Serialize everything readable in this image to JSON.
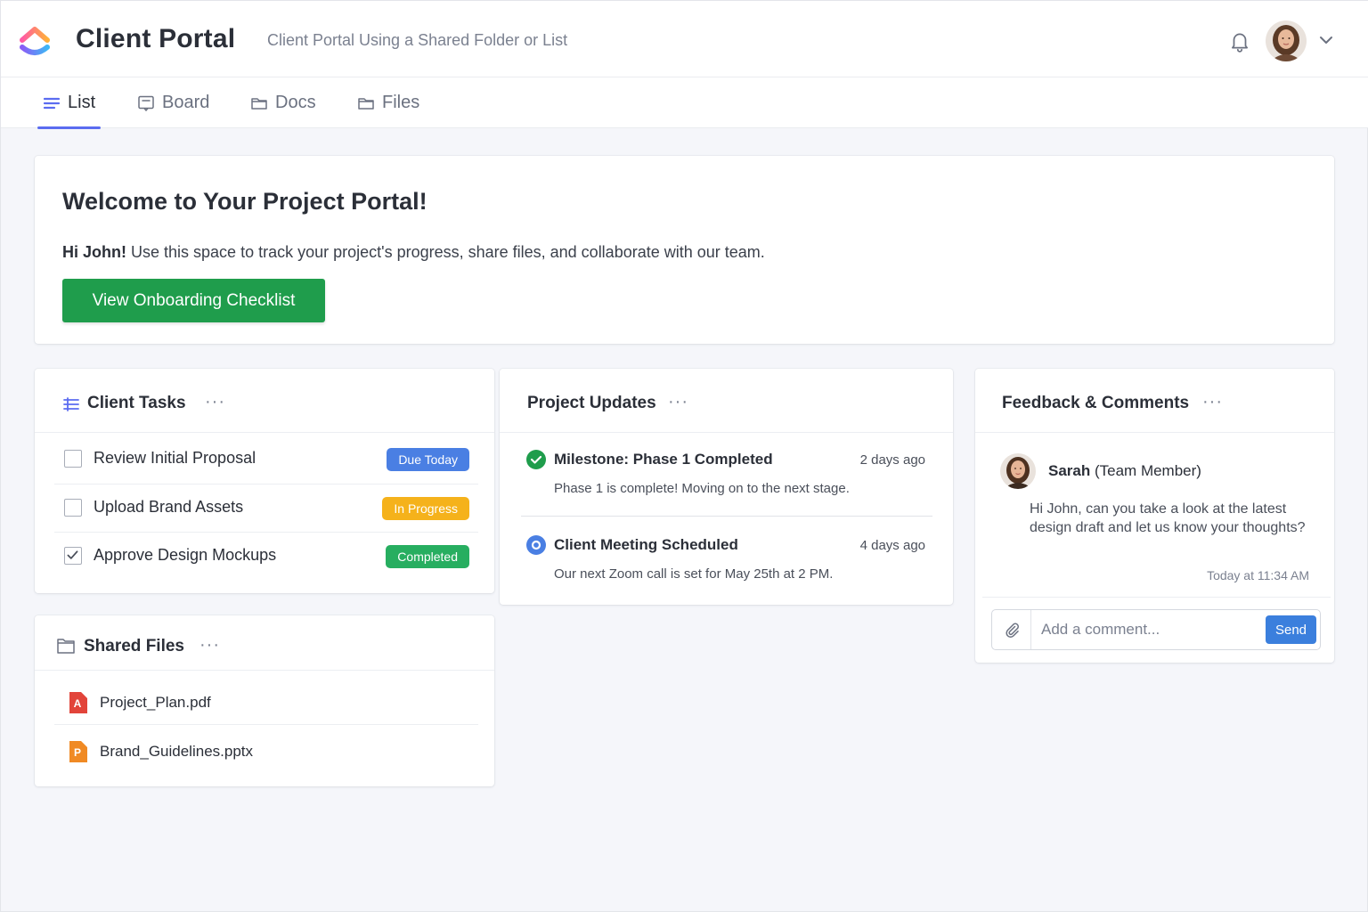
{
  "header": {
    "app_title": "Client Portal",
    "subtitle": "Client Portal Using a Shared Folder or List"
  },
  "tabs": [
    {
      "label": "List",
      "icon": "list-icon",
      "active": true
    },
    {
      "label": "Board",
      "icon": "board-icon",
      "active": false
    },
    {
      "label": "Docs",
      "icon": "folder-icon",
      "active": false
    },
    {
      "label": "Files",
      "icon": "folder-icon",
      "active": false
    }
  ],
  "welcome": {
    "title": "Welcome to Your Project Portal!",
    "greeting_name": "Hi John!",
    "message": "Use this space to track your project's progress, share files, and collaborate with our team.",
    "button_label": "View Onboarding Checklist"
  },
  "client_tasks": {
    "title": "Client Tasks",
    "menu": "···",
    "items": [
      {
        "label": "Review Initial Proposal",
        "checked": false,
        "status": "Due Today",
        "status_color": "#4a7fe3"
      },
      {
        "label": "Upload Brand Assets",
        "checked": false,
        "status": "In Progress",
        "status_color": "#f5b21b"
      },
      {
        "label": "Approve Design Mockups",
        "checked": true,
        "status": "Completed",
        "status_color": "#27ae60"
      }
    ]
  },
  "shared_files": {
    "title": "Shared Files",
    "menu": "···",
    "items": [
      {
        "name": "Project_Plan.pdf",
        "icon": "pdf-file-icon",
        "icon_letter": "A",
        "color": "#e2443a"
      },
      {
        "name": "Brand_Guidelines.pptx",
        "icon": "pptx-file-icon",
        "icon_letter": "P",
        "color": "#f08a24"
      }
    ]
  },
  "project_updates": {
    "title": "Project Updates",
    "menu": "···",
    "items": [
      {
        "title": "Milestone: Phase 1 Completed",
        "time": "2 days ago",
        "text": "Phase 1 is complete! Moving on to the next stage.",
        "icon": "check-circle-icon"
      },
      {
        "title": "Client Meeting Scheduled",
        "time": "4 days ago",
        "text": "Our next Zoom call is set for May 25th at 2 PM.",
        "icon": "scheduled-circle-icon"
      }
    ]
  },
  "feedback": {
    "title": "Feedback & Comments",
    "menu": "···",
    "author": "Sarah",
    "role": "(Team Member)",
    "comment": "Hi John, can you take a look at the latest design draft and let us know your thoughts?",
    "time": "Today at 11:34 AM",
    "input_placeholder": "Add a comment...",
    "send_label": "Send"
  },
  "colors": {
    "accent": "#5b6cf0",
    "primary_button": "#1f9d4c",
    "send_button": "#3b7fdd"
  }
}
